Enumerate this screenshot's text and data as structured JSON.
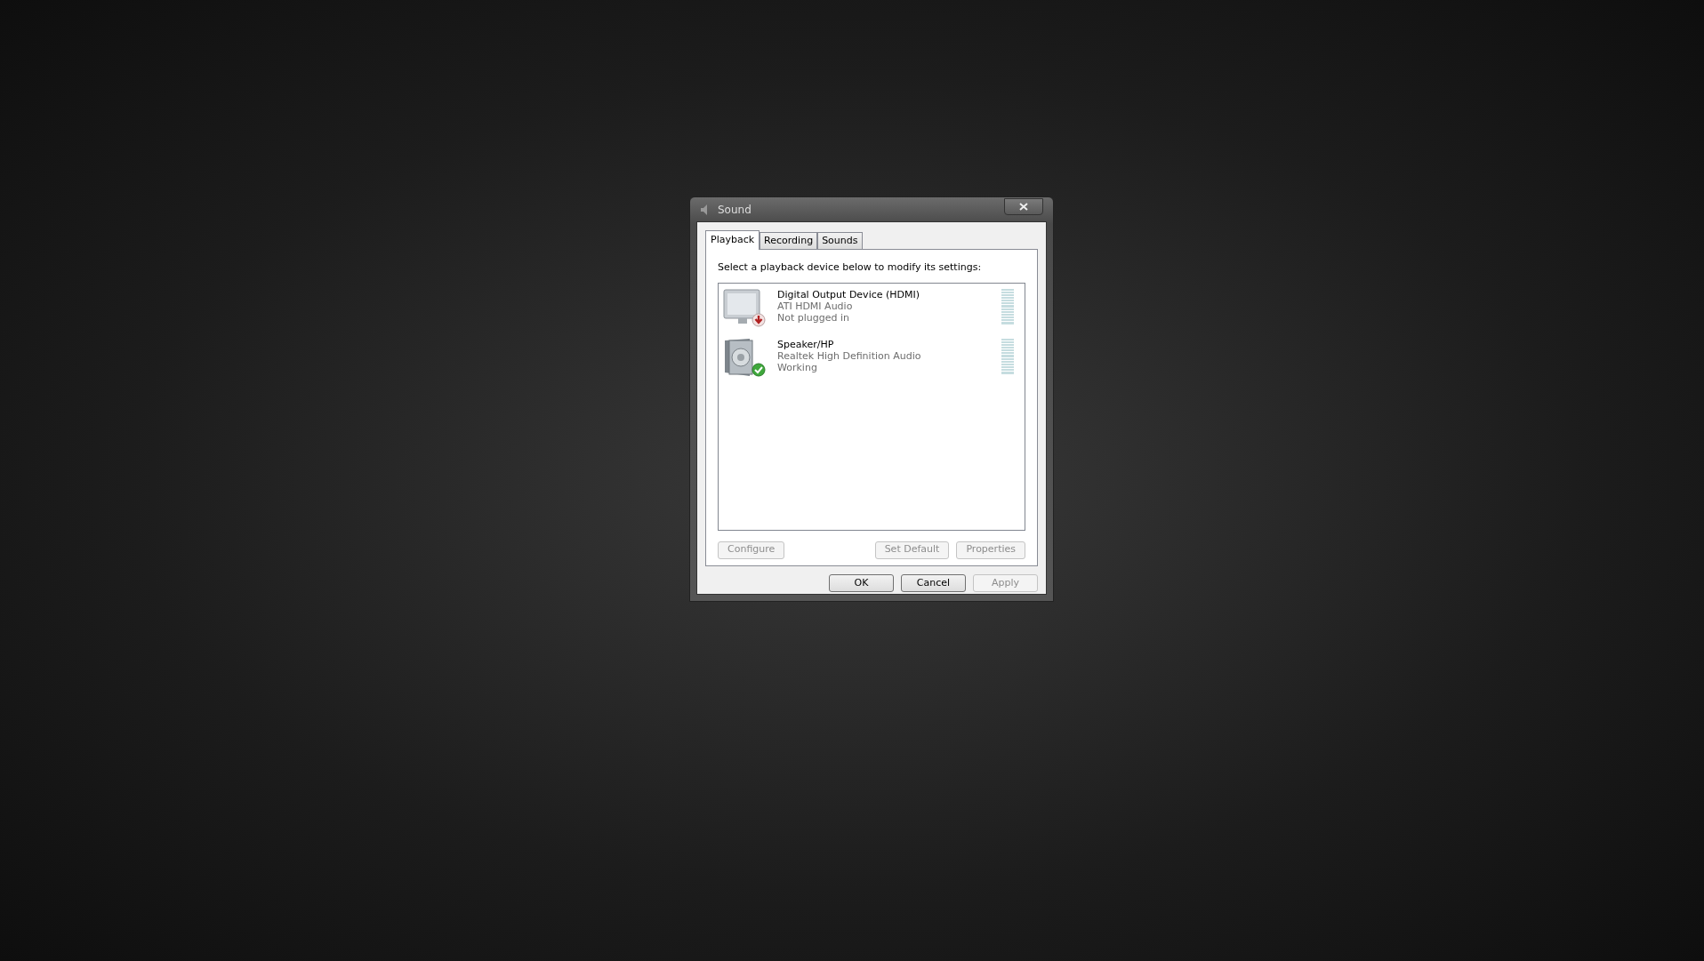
{
  "window": {
    "title": "Sound"
  },
  "tabs": [
    {
      "label": "Playback",
      "selected": true
    },
    {
      "label": "Recording",
      "selected": false
    },
    {
      "label": "Sounds",
      "selected": false
    }
  ],
  "instruction": "Select a playback device below to modify its settings:",
  "devices": [
    {
      "kind": "monitor",
      "name": "Digital Output Device (HDMI)",
      "driver": "ATI HDMI Audio",
      "status": "Not plugged in",
      "unplugged": true,
      "is_default": false
    },
    {
      "kind": "speaker",
      "name": "Speaker/HP",
      "driver": "Realtek High Definition Audio",
      "status": "Working",
      "unplugged": false,
      "is_default": true
    }
  ],
  "panel_buttons": [
    {
      "label": "Configure",
      "disabled": true
    },
    {
      "label": "Set Default",
      "disabled": true
    },
    {
      "label": "Properties",
      "disabled": true
    }
  ],
  "dialog_buttons": [
    {
      "label": "OK",
      "disabled": false
    },
    {
      "label": "Cancel",
      "disabled": false
    },
    {
      "label": "Apply",
      "disabled": true
    }
  ]
}
